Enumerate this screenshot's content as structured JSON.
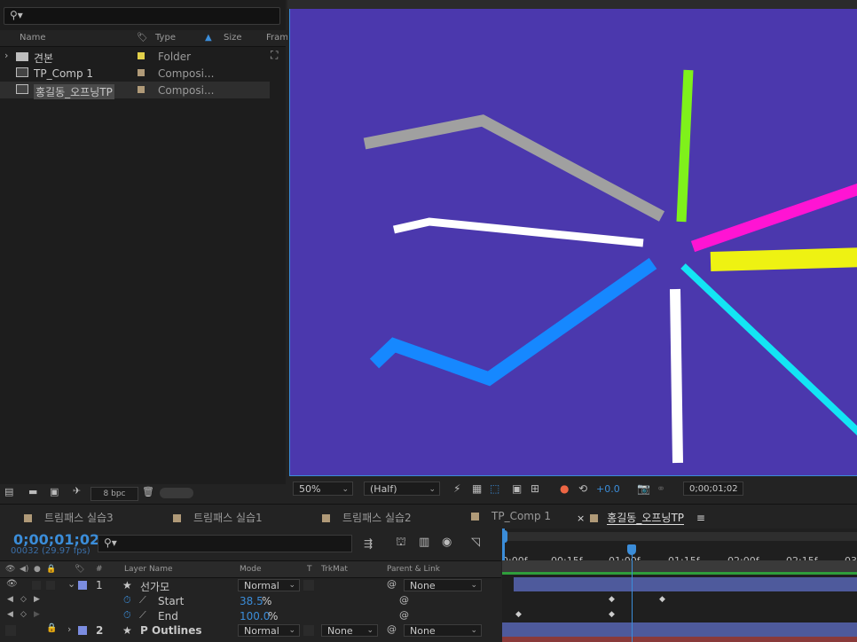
{
  "project": {
    "columns": {
      "name": "Name",
      "type": "Type",
      "size": "Size",
      "frame": "Fram"
    },
    "items": [
      {
        "name": "견본",
        "type": "Folder",
        "swatch": "#e2d04a",
        "icon": "folder-icon"
      },
      {
        "name": "TP_Comp 1",
        "type": "Composi...",
        "swatch": "#b09a78",
        "icon": "composition-icon"
      },
      {
        "name": "홍길동_오프닝TP",
        "type": "Composi...",
        "swatch": "#b09a78",
        "icon": "composition-icon"
      }
    ],
    "bpc": "8 bpc"
  },
  "viewer": {
    "zoom": "50%",
    "resolution": "(Half)",
    "exposure": "+0.0",
    "timecode": "0;00;01;02",
    "background": "#4b38ad"
  },
  "timeline": {
    "tabs": [
      "트림패스 실습3",
      "트림패스 실습1",
      "트림패스 실습2",
      "TP_Comp 1",
      "홍길동_오프닝TP"
    ],
    "active_tab": "홍길동_오프닝TP",
    "timecode": "0;00;01;02",
    "frames": "00032 (29.97 fps)",
    "columns": {
      "num": "#",
      "layer": "Layer Name",
      "mode": "Mode",
      "t": "T",
      "trkmat": "TrkMat",
      "parent": "Parent & Link"
    },
    "layers": [
      {
        "num": "1",
        "name": "선가모",
        "mode": "Normal",
        "parent": "None",
        "color": "#7b8ce0"
      },
      {
        "num": "2",
        "name": "P Outlines",
        "mode": "Normal",
        "trkmat": "None",
        "parent": "None",
        "color": "#7b8ce0"
      }
    ],
    "properties": [
      {
        "name": "Start",
        "value": "38.5",
        "unit": "%"
      },
      {
        "name": "End",
        "value": "100.0",
        "unit": "%"
      }
    ],
    "ruler": [
      "0:00f",
      "00:15f",
      "01:00f",
      "01:15f",
      "02:00f",
      "02:15f",
      "03:"
    ]
  },
  "colors": {
    "accent": "#3b8dd9",
    "comp_bg": "#4b38ad"
  }
}
